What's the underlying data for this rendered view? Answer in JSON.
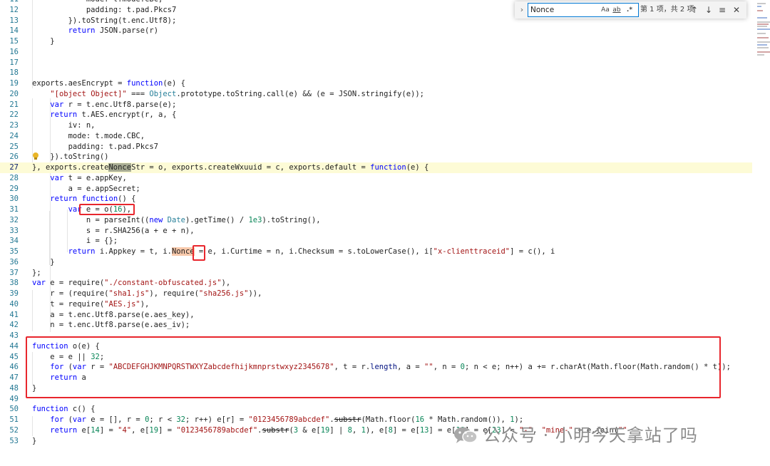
{
  "editor": {
    "lines": [
      {
        "n": "11",
        "html": "            mode: t.mode.CBC,"
      },
      {
        "n": "12",
        "html": "            padding: t.pad.Pkcs7"
      },
      {
        "n": "13",
        "html": "        }).toString(t.enc.Utf8);"
      },
      {
        "n": "14",
        "html": "        <span class=\"kw\">return</span> JSON.parse(r)"
      },
      {
        "n": "15",
        "html": "    }"
      },
      {
        "n": "16",
        "html": ""
      },
      {
        "n": "17",
        "html": ""
      },
      {
        "n": "18",
        "html": ""
      },
      {
        "n": "19",
        "html": "exports.aesEncrypt = <span class=\"kw\">function</span>(e) {"
      },
      {
        "n": "20",
        "html": "    <span class=\"str\">\"[object Object]\"</span> === <span class=\"type\">Object</span>.prototype.toString.call(e) &amp;&amp; (e = JSON.stringify(e));"
      },
      {
        "n": "21",
        "html": "    <span class=\"kw\">var</span> r = t.enc.Utf8.parse(e);"
      },
      {
        "n": "22",
        "html": "    <span class=\"kw\">return</span> t.AES.encrypt(r, a, {"
      },
      {
        "n": "23",
        "html": "        iv: n,"
      },
      {
        "n": "24",
        "html": "        mode: t.mode.CBC,"
      },
      {
        "n": "25",
        "html": "        padding: t.pad.Pkcs7"
      },
      {
        "n": "26",
        "html": "    }).toString()"
      },
      {
        "n": "27",
        "html": "}, exports.create<span class=\"hl-match\">Nonce</span>Str = o, exports.createWxuuid = c, exports.default = <span class=\"kw\">function</span>(e) {",
        "current": true
      },
      {
        "n": "28",
        "html": "    <span class=\"kw\">var</span> t = e.appKey,"
      },
      {
        "n": "29",
        "html": "        a = e.appSecret;"
      },
      {
        "n": "30",
        "html": "    <span class=\"kw\">return</span> <span class=\"kw\">function</span>() {"
      },
      {
        "n": "31",
        "html": "        <span class=\"kw\">var</span> e = o(<span class=\"num\">16</span>),"
      },
      {
        "n": "32",
        "html": "            n = parseInt((<span class=\"kw\">new</span> <span class=\"type\">Date</span>).getTime() / <span class=\"num\">1e3</span>).toString(),"
      },
      {
        "n": "33",
        "html": "            s = r.SHA256(a + e + n),"
      },
      {
        "n": "34",
        "html": "            i = {};"
      },
      {
        "n": "35",
        "html": "        <span class=\"kw\">return</span> i.Appkey = t, i.<span class=\"hl-find\">Nonce</span> = e, i.Curtime = n, i.Checksum = s.toLowerCase(), i[<span class=\"str\">\"x-clienttraceid\"</span>] = c(), i"
      },
      {
        "n": "36",
        "html": "    }"
      },
      {
        "n": "37",
        "html": "};"
      },
      {
        "n": "38",
        "html": "<span class=\"kw\">var</span> e = require(<span class=\"str\">\"./constant-obfuscated.js\"</span>),"
      },
      {
        "n": "39",
        "html": "    r = (require(<span class=\"str\">\"sha1.js\"</span>), require(<span class=\"str\">\"sha256.js\"</span>)),"
      },
      {
        "n": "40",
        "html": "    t = require(<span class=\"str\">\"AES.js\"</span>),"
      },
      {
        "n": "41",
        "html": "    a = t.enc.Utf8.parse(e.aes_key),"
      },
      {
        "n": "42",
        "html": "    n = t.enc.Utf8.parse(e.aes_iv);"
      },
      {
        "n": "43",
        "html": ""
      },
      {
        "n": "44",
        "html": "<span class=\"kw\">function</span> o(e) {"
      },
      {
        "n": "45",
        "html": "    e = e || <span class=\"num\">32</span>;"
      },
      {
        "n": "46",
        "html": "    <span class=\"kw\">for</span> (<span class=\"kw\">var</span> r = <span class=\"str\">\"ABCDEFGHJKMNPQRSTWXYZabcdefhijkmnprstwxyz2345678\"</span>, t = r.<span class=\"var\">length</span>, a = <span class=\"str\">\"\"</span>, n = <span class=\"num\">0</span>; n &lt; e; n++) a += r.charAt(Math.floor(Math.random() * t));"
      },
      {
        "n": "47",
        "html": "    <span class=\"kw\">return</span> a"
      },
      {
        "n": "48",
        "html": "}"
      },
      {
        "n": "49",
        "html": ""
      },
      {
        "n": "50",
        "html": "<span class=\"kw\">function</span> c() {"
      },
      {
        "n": "51",
        "html": "    <span class=\"kw\">for</span> (<span class=\"kw\">var</span> e = [], r = <span class=\"num\">0</span>; r &lt; <span class=\"num\">32</span>; r++) e[r] = <span class=\"str\">\"0123456789abcdef\"</span>.<span class=\"strike\">substr</span>(Math.floor(<span class=\"num\">16</span> * Math.random()), <span class=\"num\">1</span>);"
      },
      {
        "n": "52",
        "html": "    <span class=\"kw\">return</span> e[<span class=\"num\">14</span>] = <span class=\"str\">\"4\"</span>, e[<span class=\"num\">19</span>] = <span class=\"str\">\"0123456789abcdef\"</span>.<span class=\"strike\">substr</span>(<span class=\"num\">3</span> &amp; e[<span class=\"num\">19</span>] | <span class=\"num\">8</span>, <span class=\"num\">1</span>), e[<span class=\"num\">8</span>] = e[<span class=\"num\">13</span>] = e[<span class=\"num\">18</span>] = e[<span class=\"num\">23</span>] = <span class=\"str\">\"-\"</span>, <span class=\"str\">\"mine-\"</span> + e.join(<span class=\"str\">\"\"</span>"
      },
      {
        "n": "53",
        "html": "}"
      }
    ]
  },
  "find_widget": {
    "toggle_icon": "chevron-right-icon",
    "query": "Nonce",
    "match_case": "Aa",
    "whole_word": "ab",
    "regex": ".*",
    "result_count": "第 1 项，共 2 项",
    "prev_icon": "arrow-up-icon",
    "next_icon": "arrow-down-icon",
    "selection_icon": "find-in-selection-icon",
    "close_icon": "close-icon"
  },
  "watermark": {
    "text": "公众号 · 小明今天拿站了吗",
    "icon": "wechat-icon"
  },
  "colors": {
    "annotation_red": "#e8262d",
    "keyword": "#0000ff",
    "string": "#a31515",
    "number": "#098658",
    "current_line": "#fdfbd6",
    "find_match": "#f8c9ab",
    "selection_match": "#a8ac94"
  }
}
